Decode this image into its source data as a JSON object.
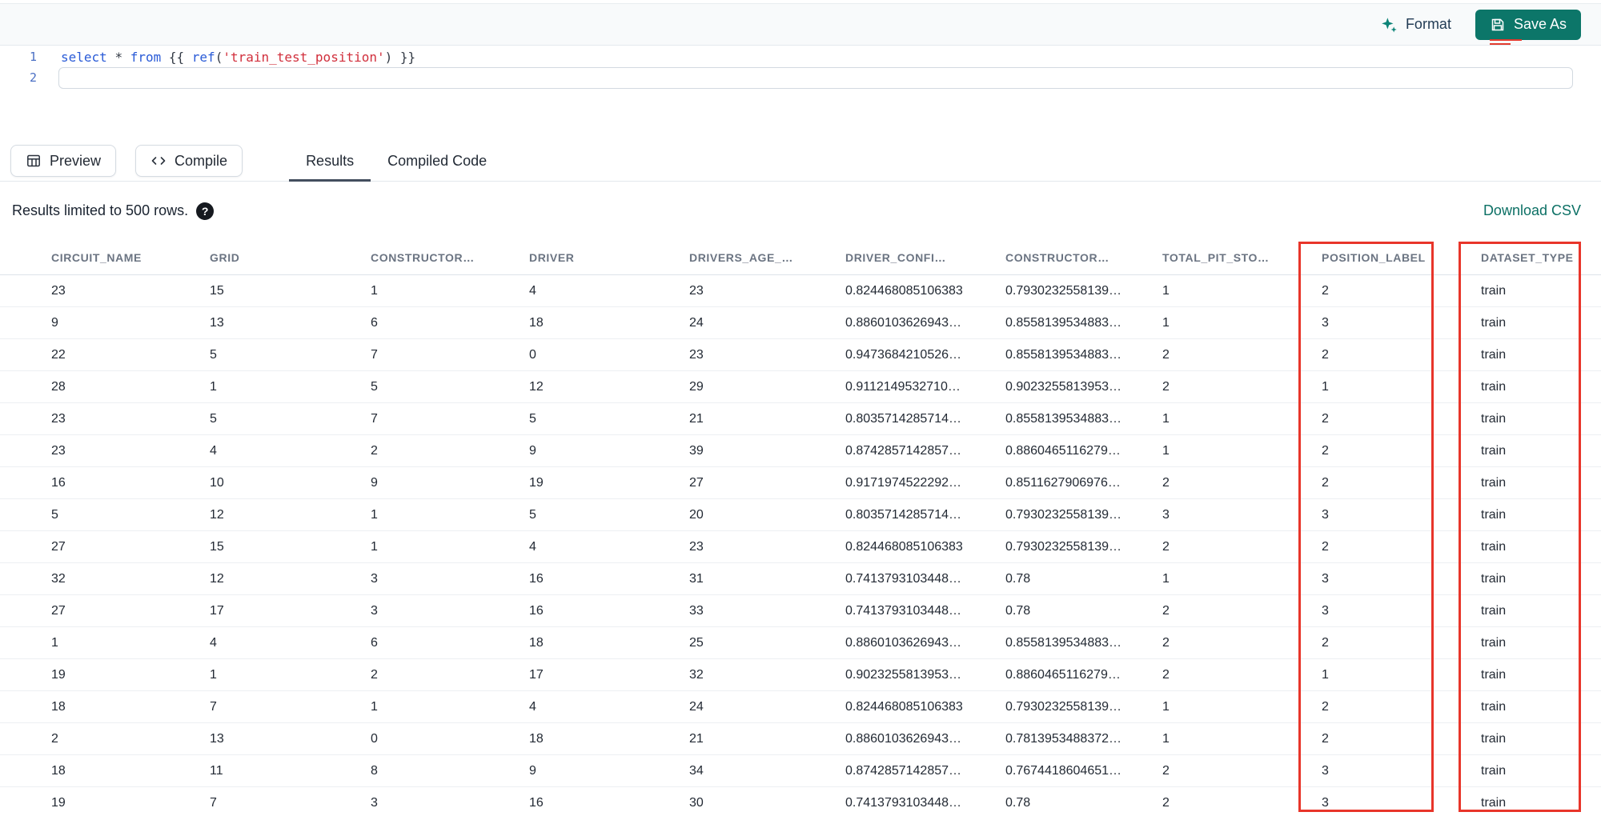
{
  "topbar": {
    "format_label": "Format",
    "save_as_label": "Save As"
  },
  "editor": {
    "line_numbers": [
      "1",
      "2"
    ],
    "sql_text": "select * from {{ ref('train_test_position') }}",
    "sql_tokens": [
      {
        "text": "select",
        "type": "keyword"
      },
      {
        "text": " ",
        "type": "plain"
      },
      {
        "text": "*",
        "type": "plain"
      },
      {
        "text": " ",
        "type": "plain"
      },
      {
        "text": "from",
        "type": "keyword"
      },
      {
        "text": " {{ ",
        "type": "plain"
      },
      {
        "text": "ref",
        "type": "function"
      },
      {
        "text": "(",
        "type": "plain"
      },
      {
        "text": "'train_test_position'",
        "type": "string"
      },
      {
        "text": ") }}",
        "type": "plain"
      }
    ]
  },
  "actions": {
    "preview_label": "Preview",
    "compile_label": "Compile"
  },
  "tabs": {
    "results": "Results",
    "compiled_code": "Compiled Code"
  },
  "results": {
    "limit_text": "Results limited to 500 rows.",
    "help_glyph": "?",
    "download_label": "Download CSV",
    "highlighted_columns": [
      "POSITION_LABEL",
      "DATASET_TYPE"
    ],
    "columns": [
      "CIRCUIT_NAME",
      "GRID",
      "CONSTRUCTOR…",
      "DRIVER",
      "DRIVERS_AGE_…",
      "DRIVER_CONFI…",
      "CONSTRUCTOR…",
      "TOTAL_PIT_STO…",
      "POSITION_LABEL",
      "DATASET_TYPE"
    ],
    "rows": [
      [
        "23",
        "15",
        "1",
        "4",
        "23",
        "0.824468085106383",
        "0.7930232558139…",
        "1",
        "2",
        "train"
      ],
      [
        "9",
        "13",
        "6",
        "18",
        "24",
        "0.8860103626943…",
        "0.8558139534883…",
        "1",
        "3",
        "train"
      ],
      [
        "22",
        "5",
        "7",
        "0",
        "23",
        "0.9473684210526…",
        "0.8558139534883…",
        "2",
        "2",
        "train"
      ],
      [
        "28",
        "1",
        "5",
        "12",
        "29",
        "0.9112149532710…",
        "0.9023255813953…",
        "2",
        "1",
        "train"
      ],
      [
        "23",
        "5",
        "7",
        "5",
        "21",
        "0.8035714285714…",
        "0.8558139534883…",
        "1",
        "2",
        "train"
      ],
      [
        "23",
        "4",
        "2",
        "9",
        "39",
        "0.8742857142857…",
        "0.8860465116279…",
        "1",
        "2",
        "train"
      ],
      [
        "16",
        "10",
        "9",
        "19",
        "27",
        "0.9171974522292…",
        "0.8511627906976…",
        "2",
        "2",
        "train"
      ],
      [
        "5",
        "12",
        "1",
        "5",
        "20",
        "0.8035714285714…",
        "0.7930232558139…",
        "3",
        "3",
        "train"
      ],
      [
        "27",
        "15",
        "1",
        "4",
        "23",
        "0.824468085106383",
        "0.7930232558139…",
        "2",
        "2",
        "train"
      ],
      [
        "32",
        "12",
        "3",
        "16",
        "31",
        "0.7413793103448…",
        "0.78",
        "1",
        "3",
        "train"
      ],
      [
        "27",
        "17",
        "3",
        "16",
        "33",
        "0.7413793103448…",
        "0.78",
        "2",
        "3",
        "train"
      ],
      [
        "1",
        "4",
        "6",
        "18",
        "25",
        "0.8860103626943…",
        "0.8558139534883…",
        "2",
        "2",
        "train"
      ],
      [
        "19",
        "1",
        "2",
        "17",
        "32",
        "0.9023255813953…",
        "0.8860465116279…",
        "2",
        "1",
        "train"
      ],
      [
        "18",
        "7",
        "1",
        "4",
        "24",
        "0.824468085106383",
        "0.7930232558139…",
        "1",
        "2",
        "train"
      ],
      [
        "2",
        "13",
        "0",
        "18",
        "21",
        "0.8860103626943…",
        "0.7813953488372…",
        "1",
        "2",
        "train"
      ],
      [
        "18",
        "11",
        "8",
        "9",
        "34",
        "0.8742857142857…",
        "0.7674418604651…",
        "2",
        "3",
        "train"
      ],
      [
        "19",
        "7",
        "3",
        "16",
        "30",
        "0.7413793103448…",
        "0.78",
        "2",
        "3",
        "train"
      ]
    ]
  },
  "colors": {
    "accent_teal": "#0c7669",
    "highlight_red": "#e8352a",
    "keyword_blue": "#2a5bd7",
    "string_red": "#d12f3c"
  }
}
